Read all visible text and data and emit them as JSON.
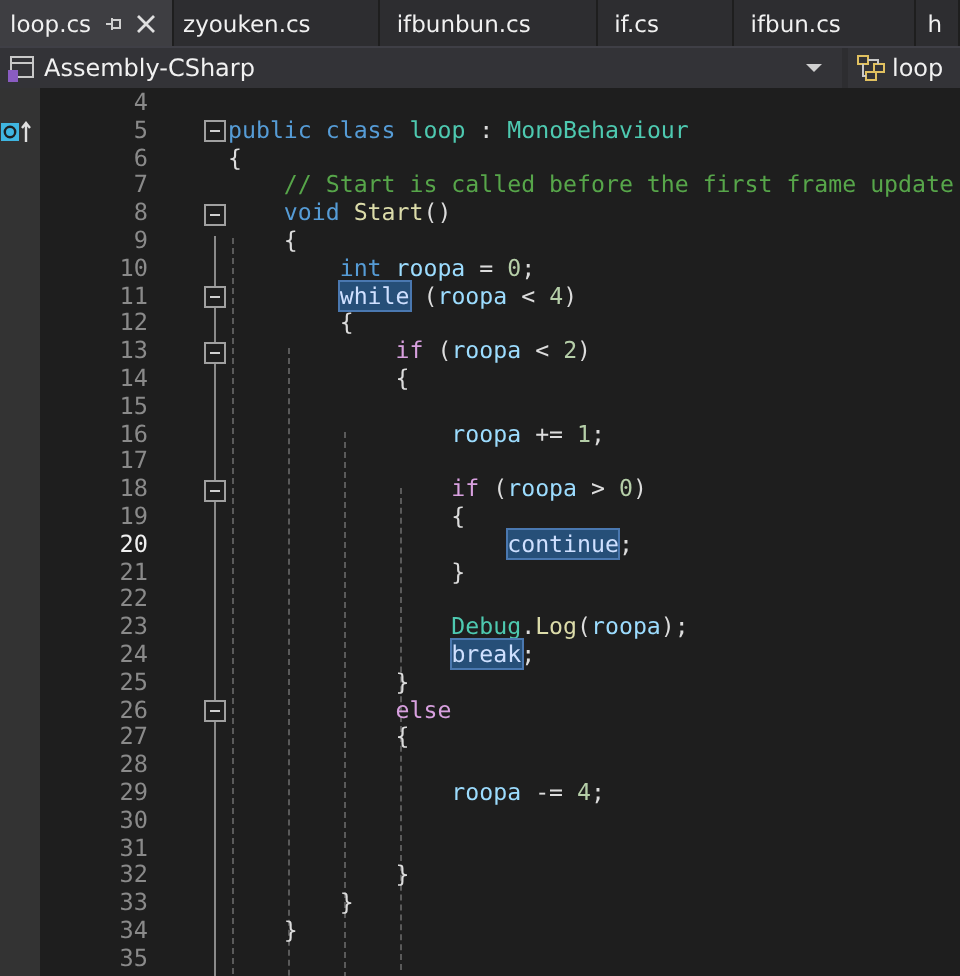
{
  "tabs": [
    {
      "label": "loop.cs",
      "selected": true
    },
    {
      "label": "zyouken.cs",
      "selected": false
    },
    {
      "label": "ifbunbun.cs",
      "selected": false
    },
    {
      "label": "if.cs",
      "selected": false
    },
    {
      "label": "ifbun.cs",
      "selected": false
    },
    {
      "label": "h",
      "selected": false
    }
  ],
  "navigation": {
    "project": "Assembly-CSharp",
    "member": "loop"
  },
  "lines": [
    {
      "number": "4",
      "current": false,
      "fold": false,
      "glyph": false
    },
    {
      "number": "5",
      "current": false,
      "fold": true,
      "glyph": true,
      "tokens": [
        {
          "text": "public",
          "kind": "keyword"
        },
        {
          "text": " class",
          "kind": "keyword"
        },
        {
          "text": " loop",
          "kind": "type"
        },
        {
          "text": " : ",
          "kind": "plain"
        },
        {
          "text": "MonoBehaviour",
          "kind": "type"
        }
      ]
    },
    {
      "number": "6",
      "current": false,
      "fold": false,
      "glyph": false,
      "tokens": [
        {
          "text": "{",
          "kind": "plain"
        }
      ]
    },
    {
      "number": "7",
      "current": false,
      "fold": false,
      "glyph": false,
      "tokens": [
        {
          "text": "    // Start is called before the first frame update",
          "kind": "comment"
        }
      ]
    },
    {
      "number": "8",
      "current": false,
      "fold": true,
      "glyph": false,
      "tokens": [
        {
          "text": "    void",
          "kind": "keyword"
        },
        {
          "text": " Start",
          "kind": "method"
        },
        {
          "text": "()",
          "kind": "plain"
        }
      ]
    },
    {
      "number": "9",
      "current": false,
      "fold": false,
      "glyph": false,
      "tokens": [
        {
          "text": "    {",
          "kind": "plain"
        }
      ]
    },
    {
      "number": "10",
      "current": false,
      "fold": false,
      "glyph": false,
      "tokens": [
        {
          "text": "        int",
          "kind": "keyword"
        },
        {
          "text": " roopa",
          "kind": "variable"
        },
        {
          "text": " = ",
          "kind": "plain"
        },
        {
          "text": "0",
          "kind": "number"
        },
        {
          "text": ";",
          "kind": "plain"
        }
      ]
    },
    {
      "number": "11",
      "current": false,
      "fold": true,
      "glyph": false,
      "tokens": [
        {
          "text": "        while",
          "kind": "marked"
        },
        {
          "text": " (",
          "kind": "plain"
        },
        {
          "text": "roopa",
          "kind": "variable"
        },
        {
          "text": " < ",
          "kind": "plain"
        },
        {
          "text": "4",
          "kind": "number"
        },
        {
          "text": ")",
          "kind": "plain"
        }
      ]
    },
    {
      "number": "12",
      "current": false,
      "fold": false,
      "glyph": false,
      "tokens": [
        {
          "text": "        {",
          "kind": "plain"
        }
      ]
    },
    {
      "number": "13",
      "current": false,
      "fold": true,
      "glyph": false,
      "tokens": [
        {
          "text": "            if",
          "kind": "control"
        },
        {
          "text": " (",
          "kind": "plain"
        },
        {
          "text": "roopa",
          "kind": "variable"
        },
        {
          "text": " < ",
          "kind": "plain"
        },
        {
          "text": "2",
          "kind": "number"
        },
        {
          "text": ")",
          "kind": "plain"
        }
      ]
    },
    {
      "number": "14",
      "current": false,
      "fold": false,
      "glyph": false,
      "tokens": [
        {
          "text": "            {",
          "kind": "plain"
        }
      ]
    },
    {
      "number": "15",
      "current": false,
      "fold": false,
      "glyph": false
    },
    {
      "number": "16",
      "current": false,
      "fold": false,
      "glyph": false,
      "tokens": [
        {
          "text": "                roopa",
          "kind": "variable"
        },
        {
          "text": " += ",
          "kind": "plain"
        },
        {
          "text": "1",
          "kind": "number"
        },
        {
          "text": ";",
          "kind": "plain"
        }
      ]
    },
    {
      "number": "17",
      "current": false,
      "fold": false,
      "glyph": false
    },
    {
      "number": "18",
      "current": false,
      "fold": true,
      "glyph": false,
      "tokens": [
        {
          "text": "                if",
          "kind": "control"
        },
        {
          "text": " (",
          "kind": "plain"
        },
        {
          "text": "roopa",
          "kind": "variable"
        },
        {
          "text": " > ",
          "kind": "plain"
        },
        {
          "text": "0",
          "kind": "number"
        },
        {
          "text": ")",
          "kind": "plain"
        }
      ]
    },
    {
      "number": "19",
      "current": false,
      "fold": false,
      "glyph": false,
      "tokens": [
        {
          "text": "                {",
          "kind": "plain"
        }
      ]
    },
    {
      "number": "20",
      "current": true,
      "fold": false,
      "glyph": false,
      "tokens": [
        {
          "text": "                    continue",
          "kind": "marked"
        },
        {
          "text": ";",
          "kind": "plain"
        }
      ]
    },
    {
      "number": "21",
      "current": false,
      "fold": false,
      "glyph": false,
      "tokens": [
        {
          "text": "                }",
          "kind": "plain"
        }
      ]
    },
    {
      "number": "22",
      "current": false,
      "fold": false,
      "glyph": false
    },
    {
      "number": "23",
      "current": false,
      "fold": false,
      "glyph": false,
      "tokens": [
        {
          "text": "                Debug",
          "kind": "type"
        },
        {
          "text": ".",
          "kind": "plain"
        },
        {
          "text": "Log",
          "kind": "method"
        },
        {
          "text": "(",
          "kind": "plain"
        },
        {
          "text": "roopa",
          "kind": "variable"
        },
        {
          "text": ");",
          "kind": "plain"
        }
      ]
    },
    {
      "number": "24",
      "current": false,
      "fold": false,
      "glyph": false,
      "tokens": [
        {
          "text": "                break",
          "kind": "marked"
        },
        {
          "text": ";",
          "kind": "plain"
        }
      ]
    },
    {
      "number": "25",
      "current": false,
      "fold": false,
      "glyph": false,
      "tokens": [
        {
          "text": "            }",
          "kind": "plain"
        }
      ]
    },
    {
      "number": "26",
      "current": false,
      "fold": true,
      "glyph": false,
      "tokens": [
        {
          "text": "            else",
          "kind": "control"
        }
      ]
    },
    {
      "number": "27",
      "current": false,
      "fold": false,
      "glyph": false,
      "tokens": [
        {
          "text": "            {",
          "kind": "plain"
        }
      ]
    },
    {
      "number": "28",
      "current": false,
      "fold": false,
      "glyph": false
    },
    {
      "number": "29",
      "current": false,
      "fold": false,
      "glyph": false,
      "tokens": [
        {
          "text": "                roopa",
          "kind": "variable"
        },
        {
          "text": " -= ",
          "kind": "plain"
        },
        {
          "text": "4",
          "kind": "number"
        },
        {
          "text": ";",
          "kind": "plain"
        }
      ]
    },
    {
      "number": "30",
      "current": false,
      "fold": false,
      "glyph": false
    },
    {
      "number": "31",
      "current": false,
      "fold": false,
      "glyph": false
    },
    {
      "number": "32",
      "current": false,
      "fold": false,
      "glyph": false,
      "tokens": [
        {
          "text": "            }",
          "kind": "plain"
        }
      ]
    },
    {
      "number": "33",
      "current": false,
      "fold": false,
      "glyph": false,
      "tokens": [
        {
          "text": "        }",
          "kind": "plain"
        }
      ]
    },
    {
      "number": "34",
      "current": false,
      "fold": false,
      "glyph": false,
      "tokens": [
        {
          "text": "    }",
          "kind": "plain"
        }
      ]
    },
    {
      "number": "35",
      "current": false,
      "fold": false,
      "glyph": false
    }
  ]
}
